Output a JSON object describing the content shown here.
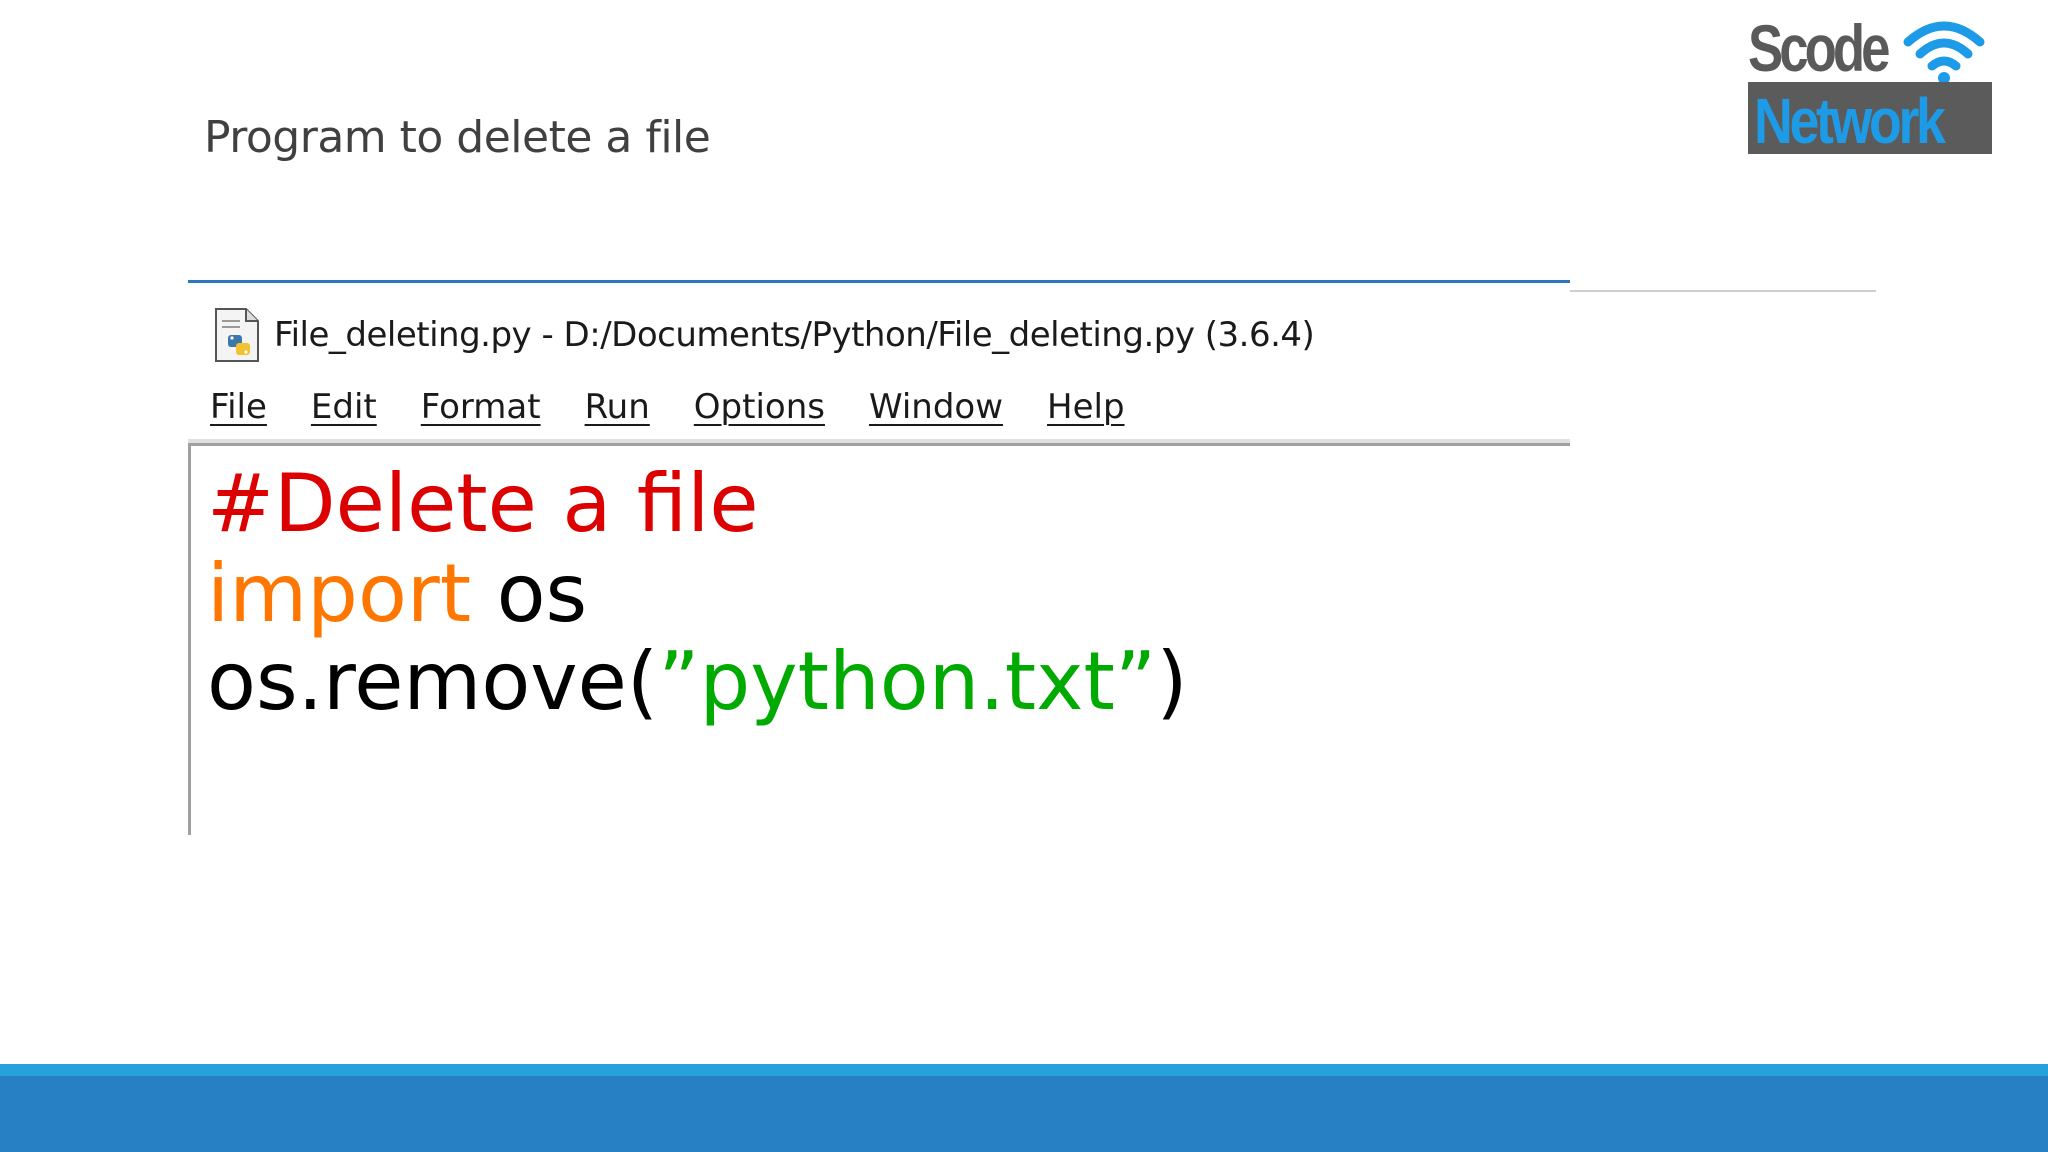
{
  "slide": {
    "title": "Program to delete a file"
  },
  "logo": {
    "line1": "Scode",
    "line2": "Network",
    "icon": "wifi-icon",
    "colors": {
      "gray": "#5a5a5a",
      "blue": "#1e9be6"
    }
  },
  "window": {
    "icon": "python-file-icon",
    "title": "File_deleting.py - D:/Documents/Python/File_deleting.py (3.6.4)"
  },
  "menu": {
    "items": [
      "File",
      "Edit",
      "Format",
      "Run",
      "Options",
      "Window",
      "Help"
    ]
  },
  "code": {
    "line1": {
      "comment": "#Delete a file"
    },
    "line2": {
      "keyword": "import",
      "rest": " os"
    },
    "line3": {
      "call": "os.remove(",
      "string": "”python.txt”",
      "close": ")"
    },
    "colors": {
      "comment": "#dd0000",
      "keyword": "#ff7700",
      "string": "#00aa00"
    }
  },
  "theme": {
    "footer": "#2780c4",
    "footer_accent": "#27a1dc",
    "rule": "#2a78b9"
  }
}
